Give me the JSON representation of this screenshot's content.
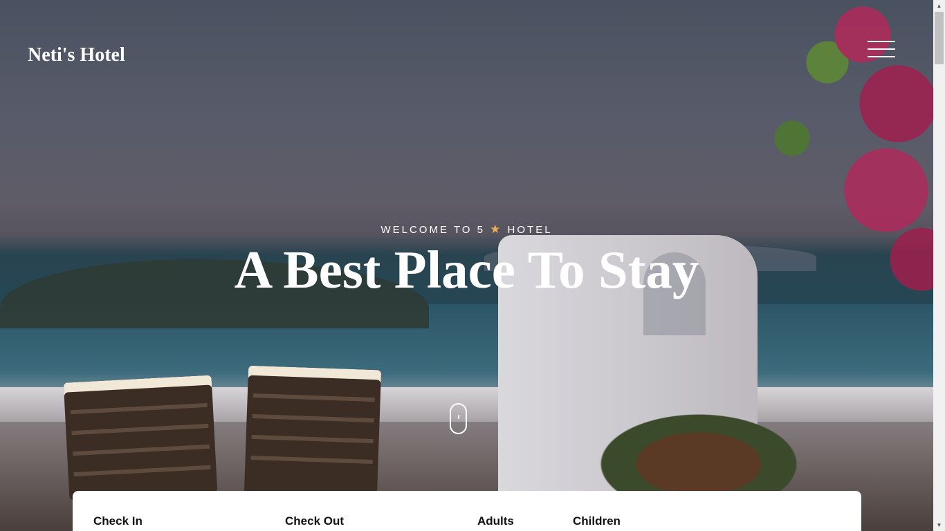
{
  "header": {
    "brand": "Neti's Hotel",
    "menu_icon": "hamburger-menu-icon"
  },
  "hero": {
    "subtitle_before": "WELCOME TO 5",
    "subtitle_star": "★",
    "subtitle_after": "HOTEL",
    "title": "A Best Place To Stay",
    "scroll_icon": "mouse-scroll-icon"
  },
  "booking": {
    "fields": [
      {
        "label": "Check In"
      },
      {
        "label": "Check Out"
      },
      {
        "label": "Adults"
      },
      {
        "label": "Children"
      }
    ]
  },
  "colors": {
    "star": "#f0ad4e",
    "text": "#ffffff",
    "form_bg": "#ffffff"
  }
}
